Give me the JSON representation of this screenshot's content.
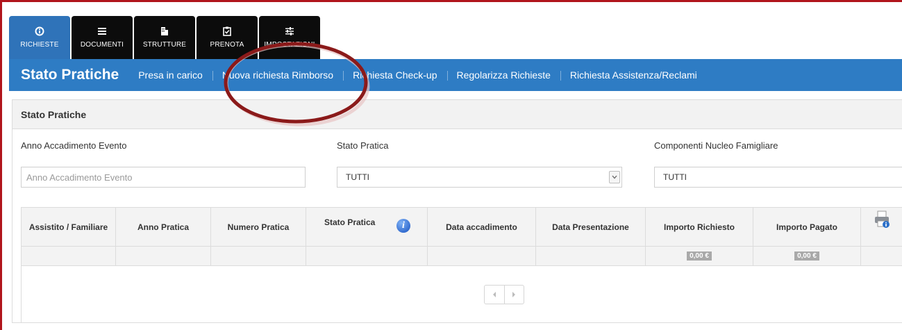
{
  "tabs": [
    {
      "label": "RICHIESTE",
      "icon": "info-circle-icon",
      "active": true
    },
    {
      "label": "DOCUMENTI",
      "icon": "menu-icon",
      "active": false
    },
    {
      "label": "STRUTTURE",
      "icon": "building-icon",
      "active": false
    },
    {
      "label": "PRENOTA",
      "icon": "checklist-icon",
      "active": false
    },
    {
      "label": "IMPOSTAZIONI",
      "icon": "sliders-icon",
      "active": false
    }
  ],
  "nav": {
    "title": "Stato Pratiche",
    "links": [
      "Presa in carico",
      "Nuova richiesta Rimborso",
      "Richiesta Check-up",
      "Regolarizza Richieste",
      "Richiesta Assistenza/Reclami"
    ]
  },
  "panel": {
    "title": "Stato Pratiche",
    "filters": {
      "anno_label": "Anno Accadimento Evento",
      "anno_placeholder": "Anno Accadimento Evento",
      "stato_label": "Stato Pratica",
      "stato_value": "TUTTI",
      "componenti_label": "Componenti Nucleo Famigliare",
      "componenti_value": "TUTTI"
    },
    "table": {
      "headers": [
        "Assistito / Familiare",
        "Anno Pratica",
        "Numero Pratica",
        "Stato Pratica",
        "Data accadimento",
        "Data Presentazione",
        "Importo Richiesto",
        "Importo Pagato"
      ],
      "totals": {
        "importo_richiesto": "0,00 €",
        "importo_pagato": "0,00 €"
      }
    }
  },
  "colors": {
    "nav_blue": "#2e7cc4",
    "tab_active": "#2f73b9",
    "annotation": "#8b1a1a",
    "frame": "#b1151c"
  }
}
